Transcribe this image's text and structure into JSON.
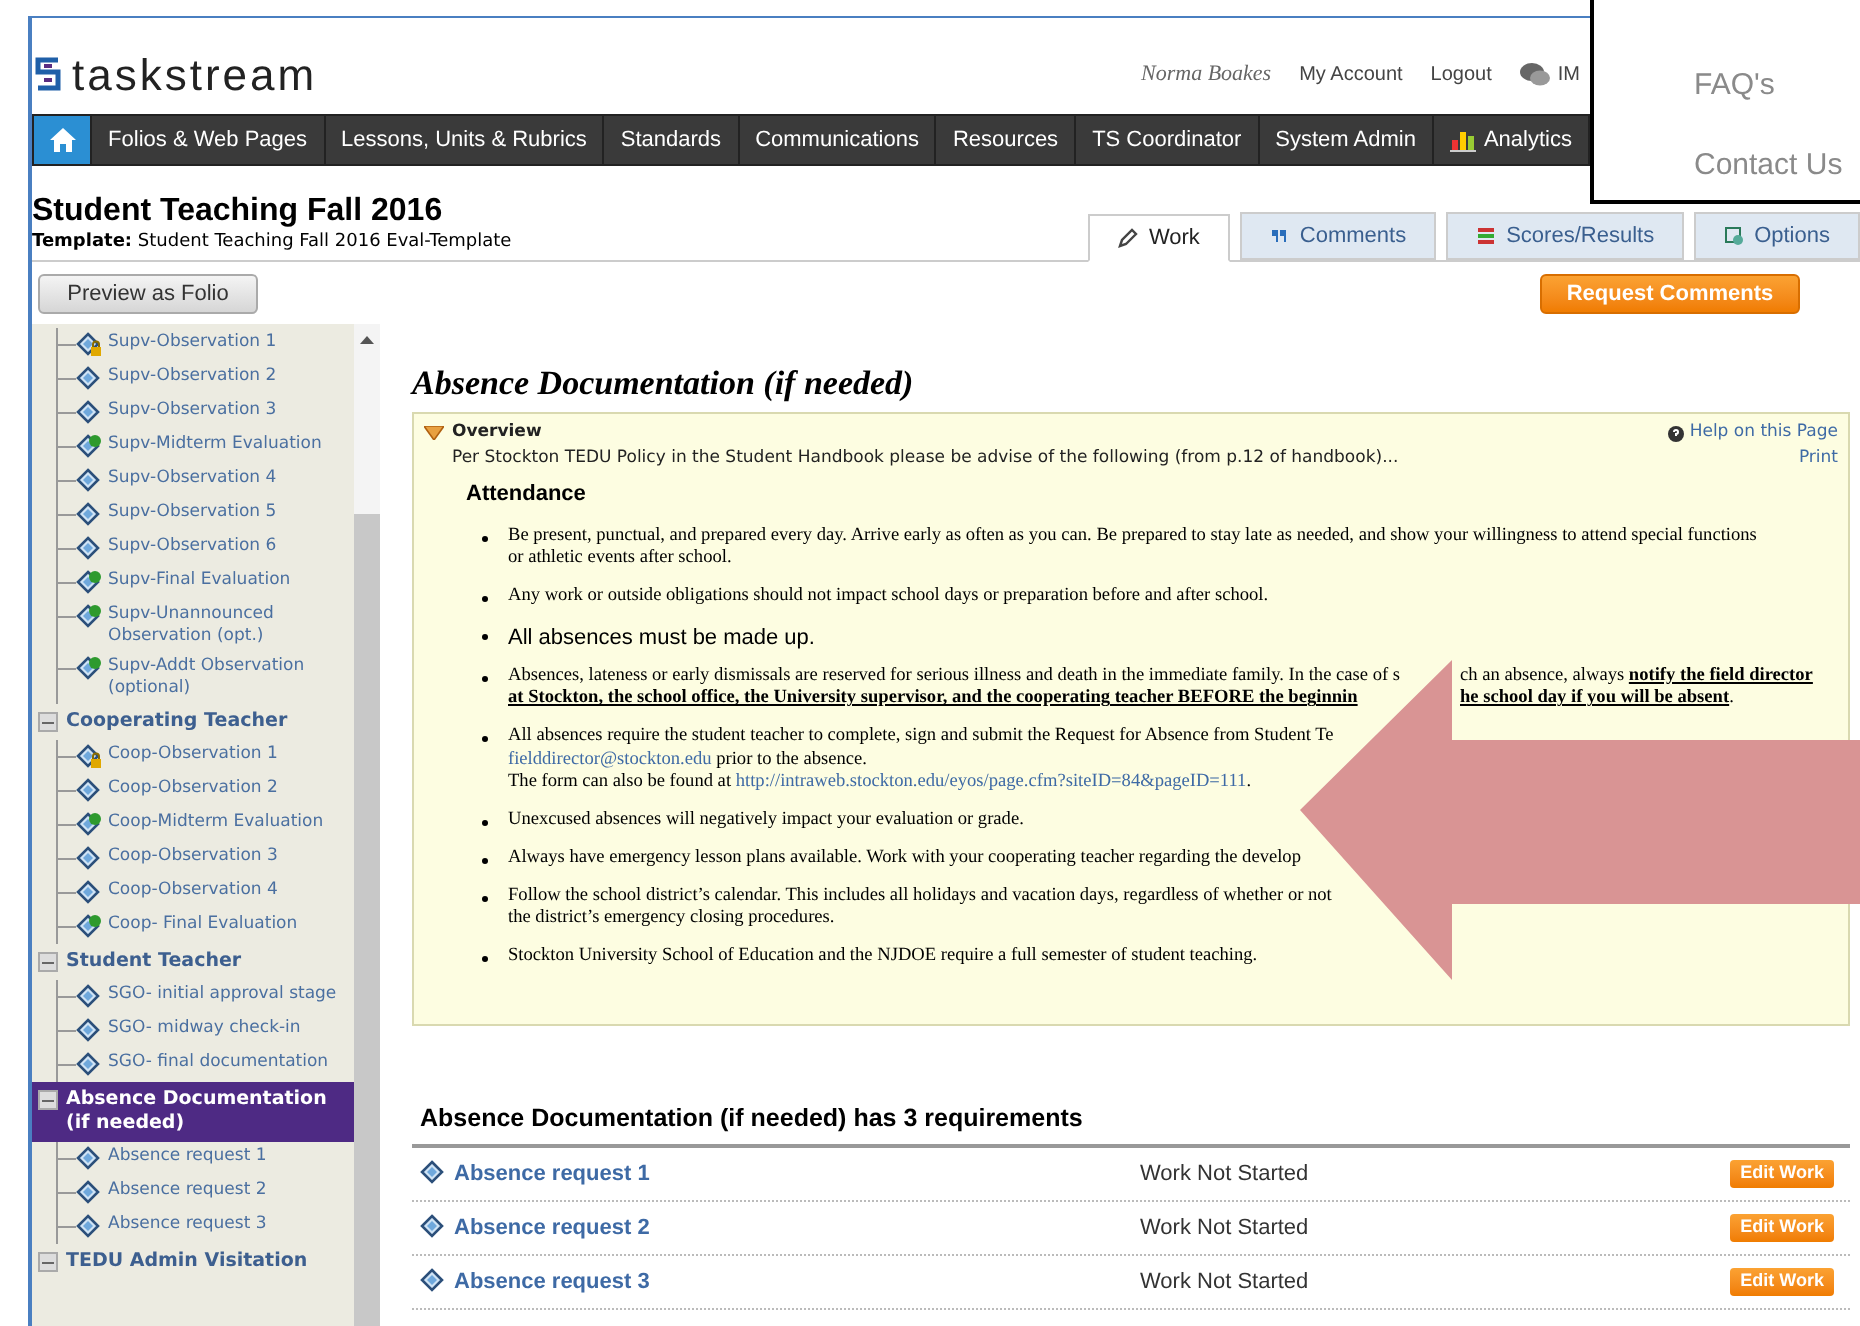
{
  "header": {
    "logo": "taskstream",
    "user": "Norma Boakes",
    "links": [
      "My Account",
      "Logout"
    ],
    "im": "IM"
  },
  "nav": [
    {
      "kind": "home",
      "selected": true
    },
    {
      "kind": "text",
      "label": "Folios & Web Pages",
      "selected": false
    },
    {
      "kind": "text",
      "label": "Lessons, Units & Rubrics",
      "selected": false
    },
    {
      "kind": "text",
      "label": "Standards",
      "selected": false
    },
    {
      "kind": "text",
      "label": "Communications",
      "selected": false
    },
    {
      "kind": "text",
      "label": "Resources",
      "selected": false
    },
    {
      "kind": "text",
      "label": "TS Coordinator",
      "selected": false
    },
    {
      "kind": "text",
      "label": "System Admin",
      "selected": false
    },
    {
      "kind": "analytics",
      "label": "Analytics",
      "selected": false
    }
  ],
  "menu": {
    "items": [
      "FAQ's",
      "Contact Us"
    ]
  },
  "title": "Student Teaching Fall 2016",
  "template_label": "Template:",
  "template": "Student Teaching Fall 2016 Eval-Template",
  "tabs": [
    {
      "kind": "work",
      "label": "Work",
      "selected": true
    },
    {
      "kind": "comments",
      "label": "Comments",
      "selected": false
    },
    {
      "kind": "scores",
      "label": "Scores/Results",
      "selected": false
    },
    {
      "kind": "options",
      "label": "Options",
      "selected": false
    }
  ],
  "preview_button": "Preview as Folio",
  "request_button": "Request Comments",
  "sidebar": {
    "sections": [
      {
        "children": [
          {
            "label": "Supv-Observation 1",
            "kind": "locked"
          },
          {
            "label": "Supv-Observation 2",
            "kind": "plain"
          },
          {
            "label": "Supv-Observation 3",
            "kind": "plain"
          },
          {
            "label": "Supv-Midterm Evaluation",
            "kind": "scored"
          },
          {
            "label": "Supv-Observation 4",
            "kind": "plain"
          },
          {
            "label": "Supv-Observation 5",
            "kind": "plain"
          },
          {
            "label": "Supv-Observation 6",
            "kind": "plain"
          },
          {
            "label": "Supv-Final Evaluation",
            "kind": "scored"
          },
          {
            "label": "Supv-Unannounced Observation (opt.)",
            "kind": "scored"
          },
          {
            "label": "Supv-Addt Observation (optional)",
            "kind": "scored"
          }
        ]
      },
      {
        "title": "Cooperating Teacher",
        "expanded": true,
        "selected": false,
        "children": [
          {
            "label": "Coop-Observation 1",
            "kind": "locked"
          },
          {
            "label": "Coop-Observation 2",
            "kind": "plain"
          },
          {
            "label": "Coop-Midterm Evaluation",
            "kind": "scored"
          },
          {
            "label": "Coop-Observation 3",
            "kind": "plain"
          },
          {
            "label": "Coop-Observation 4",
            "kind": "plain"
          },
          {
            "label": "Coop- Final Evaluation",
            "kind": "scored"
          }
        ]
      },
      {
        "title": "Student Teacher",
        "expanded": true,
        "selected": false,
        "children": [
          {
            "label": "SGO- initial approval stage",
            "kind": "plain"
          },
          {
            "label": "SGO- midway check-in",
            "kind": "plain"
          },
          {
            "label": "SGO- final documentation",
            "kind": "plain"
          }
        ]
      },
      {
        "title": "Absence Documentation (if needed)",
        "expanded": true,
        "selected": true,
        "children": [
          {
            "label": "Absence request 1",
            "kind": "plain"
          },
          {
            "label": "Absence request 2",
            "kind": "plain"
          },
          {
            "label": "Absence request 3",
            "kind": "plain"
          }
        ]
      },
      {
        "title": "TEDU Admin Visitation",
        "expanded": true,
        "selected": false
      }
    ]
  },
  "content": {
    "title": "Absence Documentation (if needed)",
    "overview": {
      "title": "Overview",
      "expanded": true,
      "help": "Help on this Page",
      "print": "Print",
      "description": "Per Stockton TEDU Policy in the Student Handbook please be advise of the following (from p.12 of handbook)...",
      "heading": "Attendance",
      "bullets": [
        {
          "kind": "serif",
          "lines": [
            [
              {
                "kind": "text",
                "text": "Be present, punctual, and prepared every day. Arrive early as often as you can. Be prepared to stay late as needed, and show your willingness to attend special functions"
              }
            ],
            [
              {
                "kind": "text",
                "text": "or athletic events after school."
              }
            ]
          ]
        },
        {
          "kind": "serif",
          "lines": [
            [
              {
                "kind": "text",
                "text": "Any work or outside obligations should not impact school days or preparation before and after school."
              }
            ]
          ]
        },
        {
          "kind": "large",
          "lines": [
            [
              {
                "kind": "text",
                "text": "All absences must be made up."
              }
            ]
          ]
        },
        {
          "kind": "serif",
          "lines": [
            [
              {
                "kind": "text",
                "text": "Absences, lateness or early dismissals are reserved for serious illness and death in the immediate family. In the case of s"
              },
              {
                "kind": "covered"
              },
              {
                "kind": "text",
                "text": "ch an absence, always **notify the field director**"
              }
            ],
            [
              {
                "kind": "text",
                "text": "**at Stockton, the school office, the University supervisor, and the cooperating teacher BEFORE the beginnin**"
              },
              {
                "kind": "covered"
              },
              {
                "kind": "text",
                "text": "**he school day if you will be absent**."
              }
            ]
          ]
        },
        {
          "kind": "serif",
          "lines": [
            [
              {
                "kind": "text",
                "text": "All absences require the student teacher to complete, sign and submit the Request for Absence from Student Te"
              },
              {
                "kind": "covered"
              }
            ],
            [
              {
                "kind": "link",
                "text": "fielddirector@stockton.edu"
              },
              {
                "kind": "text",
                "text": " prior to the absence."
              }
            ],
            [
              {
                "kind": "text",
                "text": "The form can also be found at "
              },
              {
                "kind": "link",
                "text": "http://intraweb.stockton.edu/eyos/page.cfm?siteID=84&pageID=111"
              },
              {
                "kind": "text",
                "text": "."
              }
            ]
          ]
        },
        {
          "kind": "serif",
          "lines": [
            [
              {
                "kind": "text",
                "text": "Unexcused absences will negatively impact your evaluation or grade."
              }
            ]
          ]
        },
        {
          "kind": "serif",
          "lines": [
            [
              {
                "kind": "text",
                "text": "Always have emergency lesson plans available. Work with your cooperating teacher regarding the develop"
              },
              {
                "kind": "covered"
              }
            ]
          ]
        },
        {
          "kind": "serif",
          "lines": [
            [
              {
                "kind": "text",
                "text": "Follow the school district’s calendar. This includes all holidays and vacation days, regardless of whether or not"
              },
              {
                "kind": "covered"
              }
            ],
            [
              {
                "kind": "text",
                "text": "the district’s emergency closing procedures."
              }
            ]
          ]
        },
        {
          "kind": "serif",
          "lines": [
            [
              {
                "kind": "text",
                "text": "Stockton University School of Education and the NJDOE require a full semester of student teaching."
              }
            ]
          ]
        }
      ]
    },
    "requirements": {
      "heading": "Absence Documentation (if needed) has 3 requirements",
      "rows": [
        {
          "name": "Absence request 1",
          "status": "Work Not Started",
          "action": "Edit Work"
        },
        {
          "name": "Absence request 2",
          "status": "Work Not Started",
          "action": "Edit Work"
        },
        {
          "name": "Absence request 3",
          "status": "Work Not Started",
          "action": "Edit Work"
        }
      ]
    }
  }
}
